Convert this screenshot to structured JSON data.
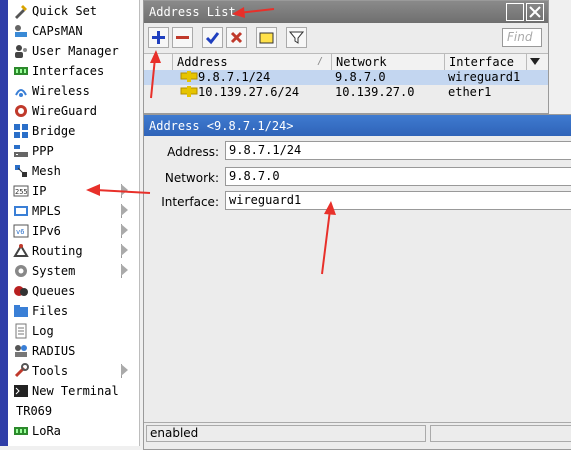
{
  "sidebar": {
    "items": [
      {
        "label": "Quick Set",
        "icon": "quick-set-icon",
        "submenu": false
      },
      {
        "label": "CAPsMAN",
        "icon": "capsman-icon",
        "submenu": false
      },
      {
        "label": "User Manager",
        "icon": "user-manager-icon",
        "submenu": false
      },
      {
        "label": "Interfaces",
        "icon": "interfaces-icon",
        "submenu": false
      },
      {
        "label": "Wireless",
        "icon": "wireless-icon",
        "submenu": false
      },
      {
        "label": "WireGuard",
        "icon": "wireguard-icon",
        "submenu": false
      },
      {
        "label": "Bridge",
        "icon": "bridge-icon",
        "submenu": false
      },
      {
        "label": "PPP",
        "icon": "ppp-icon",
        "submenu": false
      },
      {
        "label": "Mesh",
        "icon": "mesh-icon",
        "submenu": false
      },
      {
        "label": "IP",
        "icon": "ip-icon",
        "submenu": true
      },
      {
        "label": "MPLS",
        "icon": "mpls-icon",
        "submenu": true
      },
      {
        "label": "IPv6",
        "icon": "ipv6-icon",
        "submenu": true
      },
      {
        "label": "Routing",
        "icon": "routing-icon",
        "submenu": true
      },
      {
        "label": "System",
        "icon": "system-icon",
        "submenu": true
      },
      {
        "label": "Queues",
        "icon": "queues-icon",
        "submenu": false
      },
      {
        "label": "Files",
        "icon": "files-icon",
        "submenu": false
      },
      {
        "label": "Log",
        "icon": "log-icon",
        "submenu": false
      },
      {
        "label": "RADIUS",
        "icon": "radius-icon",
        "submenu": false
      },
      {
        "label": "Tools",
        "icon": "tools-icon",
        "submenu": true
      },
      {
        "label": "New Terminal",
        "icon": "terminal-icon",
        "submenu": false
      },
      {
        "label": "TR069",
        "icon": "",
        "submenu": false
      },
      {
        "label": "LoRa",
        "icon": "lora-icon",
        "submenu": false
      }
    ]
  },
  "address_list": {
    "title": "Address List",
    "find_placeholder": "Find",
    "columns": [
      "Address",
      "Network",
      "Interface"
    ],
    "rows": [
      {
        "address": "9.8.7.1/24",
        "network": "9.8.7.0",
        "interface": "wireguard1",
        "selected": true
      },
      {
        "address": "10.139.27.6/24",
        "network": "10.139.27.0",
        "interface": "ether1",
        "selected": false
      }
    ]
  },
  "address_window": {
    "title": "Address <9.8.7.1/24>",
    "address_label": "Address:",
    "address_value": "9.8.7.1/24",
    "network_label": "Network:",
    "network_value": "9.8.7.0",
    "interface_label": "Interface:",
    "interface_value": "wireguard1",
    "status": "enabled"
  },
  "colors": {
    "accent_stripe": "#2f3ea8",
    "title_bar": "#7d7d7d",
    "selected_row": "#c3d6f0",
    "annotation_arrow": "#e8302a"
  }
}
